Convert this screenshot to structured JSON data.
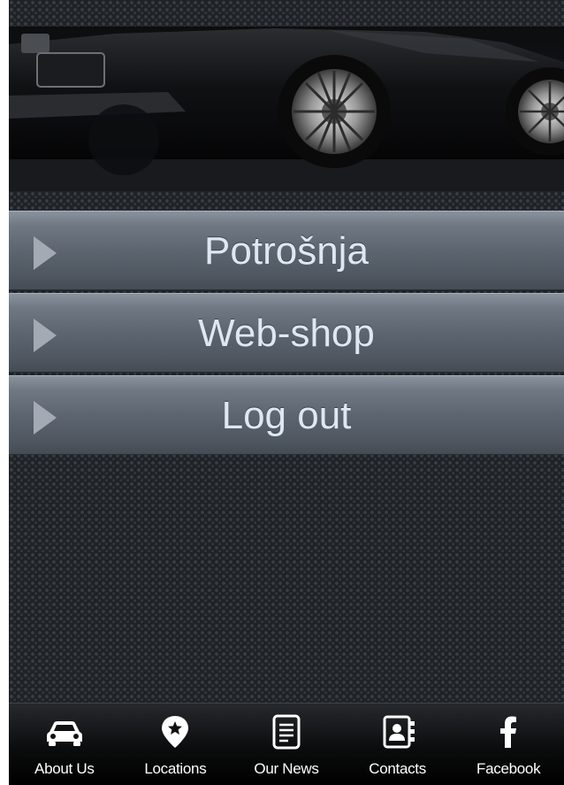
{
  "hero": {
    "image": "black-luxury-car"
  },
  "menu": {
    "items": [
      {
        "label": "Potrošnja",
        "icon": "play-arrow-icon"
      },
      {
        "label": "Web-shop",
        "icon": "play-arrow-icon"
      },
      {
        "label": "Log out",
        "icon": "play-arrow-icon"
      }
    ]
  },
  "tabbar": {
    "tabs": [
      {
        "label": "About Us",
        "icon": "car-icon"
      },
      {
        "label": "Locations",
        "icon": "map-pin-star-icon"
      },
      {
        "label": "Our News",
        "icon": "document-icon"
      },
      {
        "label": "Contacts",
        "icon": "address-book-icon"
      },
      {
        "label": "Facebook",
        "icon": "facebook-icon"
      }
    ]
  },
  "colors": {
    "menu_text": "#dde8f2",
    "menu_arrow": "#a3aab3",
    "tab_text": "#ffffff",
    "background": "#1f2226"
  }
}
